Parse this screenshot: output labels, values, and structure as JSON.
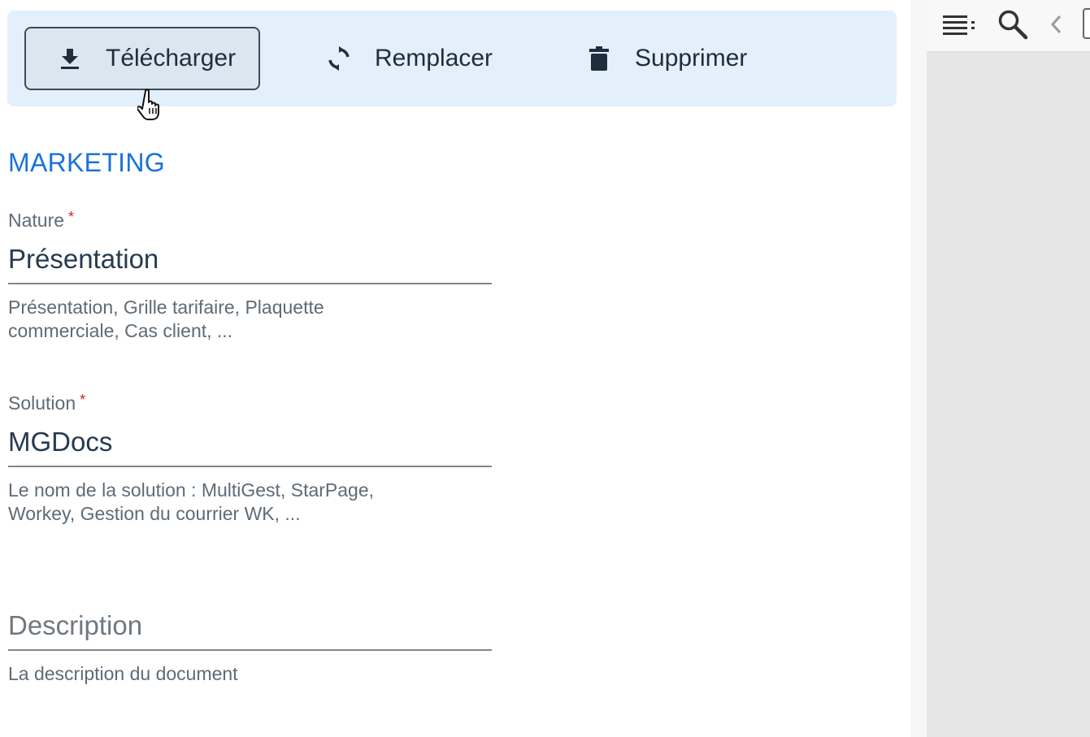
{
  "toolbar": {
    "download_label": "Télécharger",
    "replace_label": "Remplacer",
    "delete_label": "Supprimer"
  },
  "section": {
    "title": "MARKETING"
  },
  "fields": {
    "nature": {
      "label": "Nature",
      "required_mark": "*",
      "value": "Présentation",
      "help": "Présentation, Grille tarifaire, Plaquette commerciale, Cas client, ..."
    },
    "solution": {
      "label": "Solution",
      "required_mark": "*",
      "value": "MGDocs",
      "help": "Le nom de la solution : MultiGest, StarPage, Workey, Gestion du courrier WK, ..."
    },
    "description": {
      "placeholder": "Description",
      "help": "La description du document"
    }
  },
  "viewer": {
    "icons": [
      "list-icon",
      "search-icon",
      "chevron-left-icon",
      "page-icon"
    ]
  },
  "colors": {
    "accent": "#1a73d9",
    "toolbar_bg": "#e3effb",
    "required": "#d0202a",
    "viewer_bg": "#e6e6e7"
  }
}
